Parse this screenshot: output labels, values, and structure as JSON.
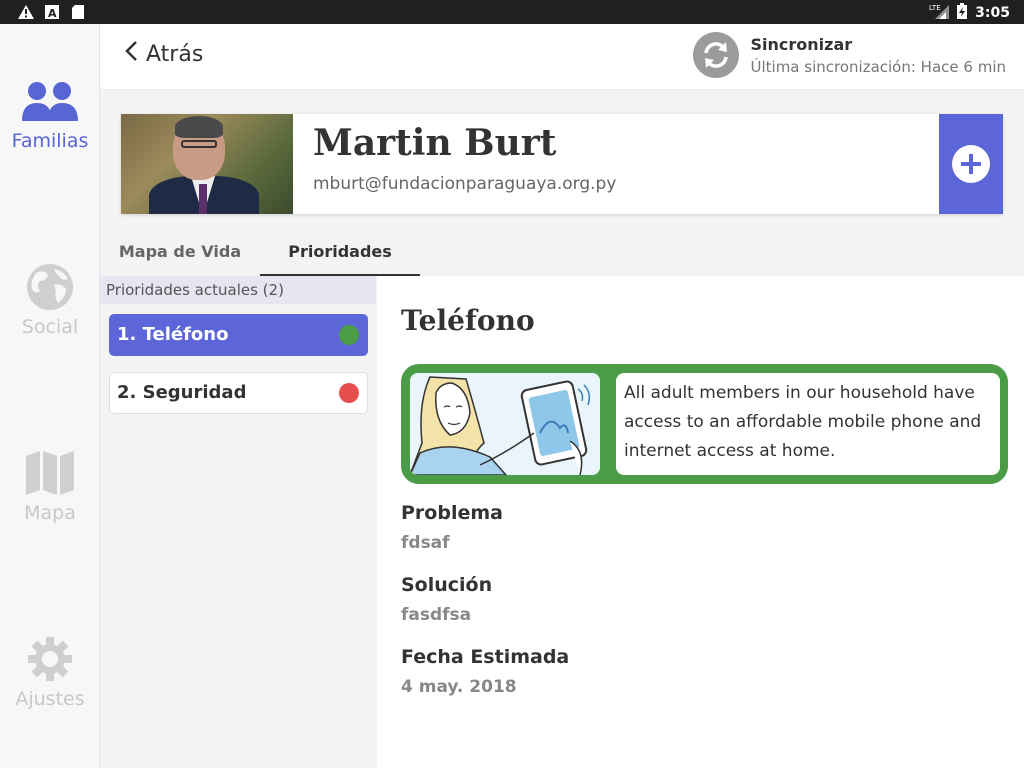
{
  "status_bar": {
    "time": "3:05",
    "network": "LTE",
    "left_icons": [
      "warning-icon",
      "font-app-icon",
      "sd-card-icon"
    ],
    "right_icons": [
      "signal-icon",
      "battery-icon"
    ]
  },
  "sidenav": {
    "items": [
      {
        "label": "Familias",
        "icon": "families-icon",
        "active": true
      },
      {
        "label": "Social",
        "icon": "globe-icon",
        "active": false
      },
      {
        "label": "Mapa",
        "icon": "map-icon",
        "active": false
      },
      {
        "label": "Ajustes",
        "icon": "gear-icon",
        "active": false
      }
    ],
    "active_color": "#5865d4",
    "inactive_color": "#c8c8c8"
  },
  "header": {
    "back_label": "Atrás",
    "sync_title": "Sincronizar",
    "sync_subtitle": "Última sincronización: Hace 6 min"
  },
  "profile": {
    "name": "Martin Burt",
    "email": "mburt@fundacionparaguaya.org.py",
    "add_icon": "plus-icon",
    "accent": "#5c66d8"
  },
  "tabs": [
    {
      "label": "Mapa de Vida",
      "active": false
    },
    {
      "label": "Prioridades",
      "active": true
    }
  ],
  "priorities": {
    "header": "Prioridades actuales (2)",
    "items": [
      {
        "label": "1. Teléfono",
        "status_color": "#4a9c46",
        "active": true
      },
      {
        "label": "2. Seguridad",
        "status_color": "#e5504f",
        "active": false
      }
    ]
  },
  "detail": {
    "title": "Teléfono",
    "indicator_text": "All adult members in our household have access to an affordable mobile phone and internet access at home.",
    "indicator_color": "#4a9c46",
    "fields": [
      {
        "label": "Problema",
        "value": "fdsaf"
      },
      {
        "label": "Solución",
        "value": "fasdfsa"
      },
      {
        "label": "Fecha Estimada",
        "value": "4 may. 2018"
      }
    ]
  }
}
